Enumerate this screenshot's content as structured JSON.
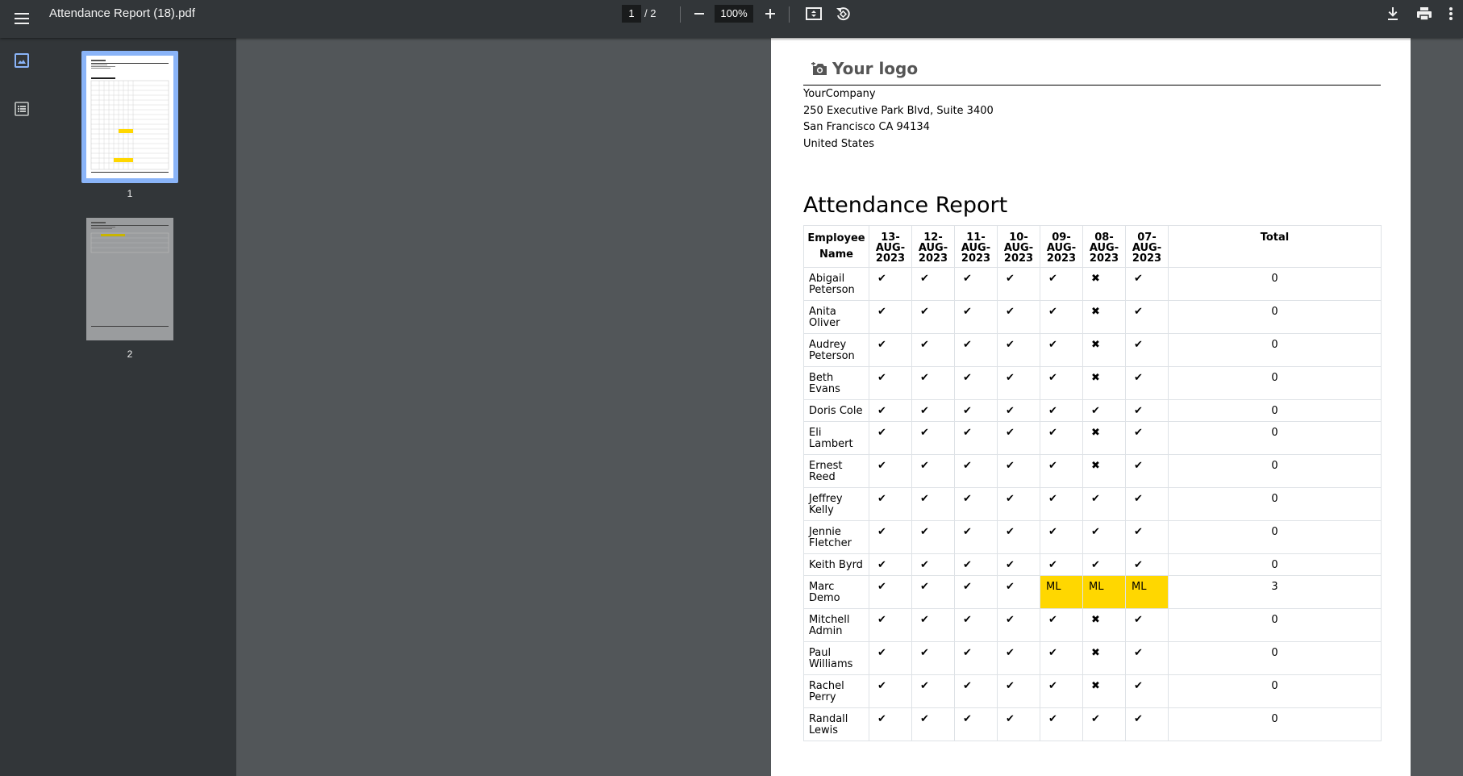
{
  "toolbar": {
    "title": "Attendance Report (18).pdf",
    "current_page": "1",
    "page_separator": "/ 2",
    "zoom": "100%"
  },
  "sidebar": {
    "thumbnails": [
      {
        "label": "1",
        "selected": true
      },
      {
        "label": "2",
        "selected": false
      }
    ]
  },
  "document": {
    "logo_text": "Your logo",
    "company": {
      "name": "YourCompany",
      "street": "250 Executive Park Blvd, Suite 3400",
      "city": "San Francisco CA 94134",
      "country": "United States"
    },
    "report_title": "Attendance Report",
    "table": {
      "name_header_1": "Employee",
      "name_header_2": "Name",
      "dates": [
        {
          "day": "13-",
          "month": "AUG-",
          "year": "2023"
        },
        {
          "day": "12-",
          "month": "AUG-",
          "year": "2023"
        },
        {
          "day": "11-",
          "month": "AUG-",
          "year": "2023"
        },
        {
          "day": "10-",
          "month": "AUG-",
          "year": "2023"
        },
        {
          "day": "09-",
          "month": "AUG-",
          "year": "2023"
        },
        {
          "day": "08-",
          "month": "AUG-",
          "year": "2023"
        },
        {
          "day": "07-",
          "month": "AUG-",
          "year": "2023"
        }
      ],
      "total_header": "Total",
      "rows": [
        {
          "name": [
            "Abigail",
            "Peterson"
          ],
          "marks": [
            "✔",
            "✔",
            "✔",
            "✔",
            "✔",
            "✖",
            "✔"
          ],
          "total": "0"
        },
        {
          "name": [
            "Anita",
            "Oliver"
          ],
          "marks": [
            "✔",
            "✔",
            "✔",
            "✔",
            "✔",
            "✖",
            "✔"
          ],
          "total": "0"
        },
        {
          "name": [
            "Audrey",
            "Peterson"
          ],
          "marks": [
            "✔",
            "✔",
            "✔",
            "✔",
            "✔",
            "✖",
            "✔"
          ],
          "total": "0"
        },
        {
          "name": [
            "Beth Evans"
          ],
          "marks": [
            "✔",
            "✔",
            "✔",
            "✔",
            "✔",
            "✖",
            "✔"
          ],
          "total": "0"
        },
        {
          "name": [
            "Doris Cole"
          ],
          "marks": [
            "✔",
            "✔",
            "✔",
            "✔",
            "✔",
            "✔",
            "✔"
          ],
          "total": "0"
        },
        {
          "name": [
            "Eli Lambert"
          ],
          "marks": [
            "✔",
            "✔",
            "✔",
            "✔",
            "✔",
            "✖",
            "✔"
          ],
          "total": "0"
        },
        {
          "name": [
            "Ernest",
            "Reed"
          ],
          "marks": [
            "✔",
            "✔",
            "✔",
            "✔",
            "✔",
            "✖",
            "✔"
          ],
          "total": "0"
        },
        {
          "name": [
            "Jeffrey",
            "Kelly"
          ],
          "marks": [
            "✔",
            "✔",
            "✔",
            "✔",
            "✔",
            "✔",
            "✔"
          ],
          "total": "0"
        },
        {
          "name": [
            "Jennie",
            "Fletcher"
          ],
          "marks": [
            "✔",
            "✔",
            "✔",
            "✔",
            "✔",
            "✔",
            "✔"
          ],
          "total": "0"
        },
        {
          "name": [
            "Keith Byrd"
          ],
          "marks": [
            "✔",
            "✔",
            "✔",
            "✔",
            "✔",
            "✔",
            "✔"
          ],
          "total": "0"
        },
        {
          "name": [
            "Marc",
            "Demo"
          ],
          "marks": [
            "✔",
            "✔",
            "✔",
            "✔",
            "ML",
            "ML",
            "ML"
          ],
          "total": "3"
        },
        {
          "name": [
            "Mitchell",
            "Admin"
          ],
          "marks": [
            "✔",
            "✔",
            "✔",
            "✔",
            "✔",
            "✖",
            "✔"
          ],
          "total": "0"
        },
        {
          "name": [
            "Paul",
            "Williams"
          ],
          "marks": [
            "✔",
            "✔",
            "✔",
            "✔",
            "✔",
            "✖",
            "✔"
          ],
          "total": "0"
        },
        {
          "name": [
            "Rachel",
            "Perry"
          ],
          "marks": [
            "✔",
            "✔",
            "✔",
            "✔",
            "✔",
            "✖",
            "✔"
          ],
          "total": "0"
        },
        {
          "name": [
            "Randall",
            "Lewis"
          ],
          "marks": [
            "✔",
            "✔",
            "✔",
            "✔",
            "✔",
            "✔",
            "✔"
          ],
          "total": "0"
        }
      ]
    }
  },
  "colors": {
    "toolbar_bg": "#323639",
    "viewer_bg": "#525659",
    "leave_highlight": "#ffd700",
    "selected_thumb_border": "#8ab4f8"
  }
}
